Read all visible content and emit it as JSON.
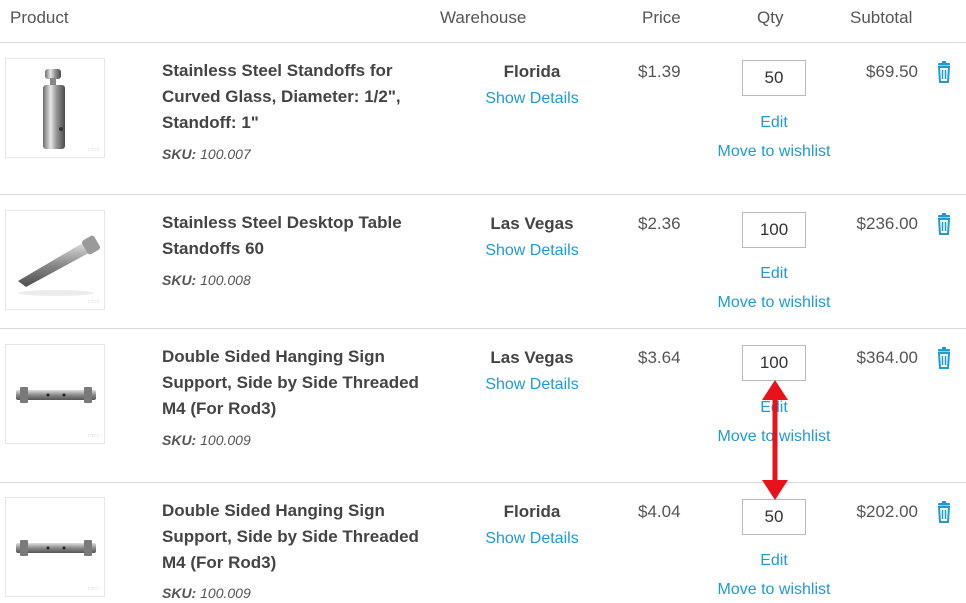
{
  "header": {
    "product": "Product",
    "warehouse": "Warehouse",
    "price": "Price",
    "qty": "Qty",
    "subtotal": "Subtotal"
  },
  "links": {
    "show_details": "Show Details",
    "edit": "Edit",
    "move_to_wishlist": "Move to wishlist"
  },
  "sku_label": "SKU:",
  "items": [
    {
      "name": "Stainless Steel Standoffs for Curved Glass, Diameter: 1/2\", Standoff: 1\"",
      "sku": "100.007",
      "warehouse": "Florida",
      "price": "$1.39",
      "qty": "50",
      "subtotal": "$69.50",
      "image_icon": "cylinder-standoff"
    },
    {
      "name": "Stainless Steel Desktop Table Standoffs 60",
      "sku": "100.008",
      "warehouse": "Las Vegas",
      "price": "$2.36",
      "qty": "100",
      "subtotal": "$236.00",
      "image_icon": "angled-desktop-standoff"
    },
    {
      "name": "Double Sided Hanging Sign Support, Side by Side Threaded M4 (For Rod3)",
      "sku": "100.009",
      "warehouse": "Las Vegas",
      "price": "$3.64",
      "qty": "100",
      "subtotal": "$364.00",
      "image_icon": "double-sided-sign-support"
    },
    {
      "name": "Double Sided Hanging Sign Support, Side by Side Threaded M4 (For Rod3)",
      "sku": "100.009",
      "warehouse": "Florida",
      "price": "$4.04",
      "qty": "50",
      "subtotal": "$202.00",
      "image_icon": "double-sided-sign-support"
    }
  ],
  "colors": {
    "link": "#1f9ad6",
    "annotation_arrow": "#e8121b",
    "divider": "#d9d9d9"
  }
}
